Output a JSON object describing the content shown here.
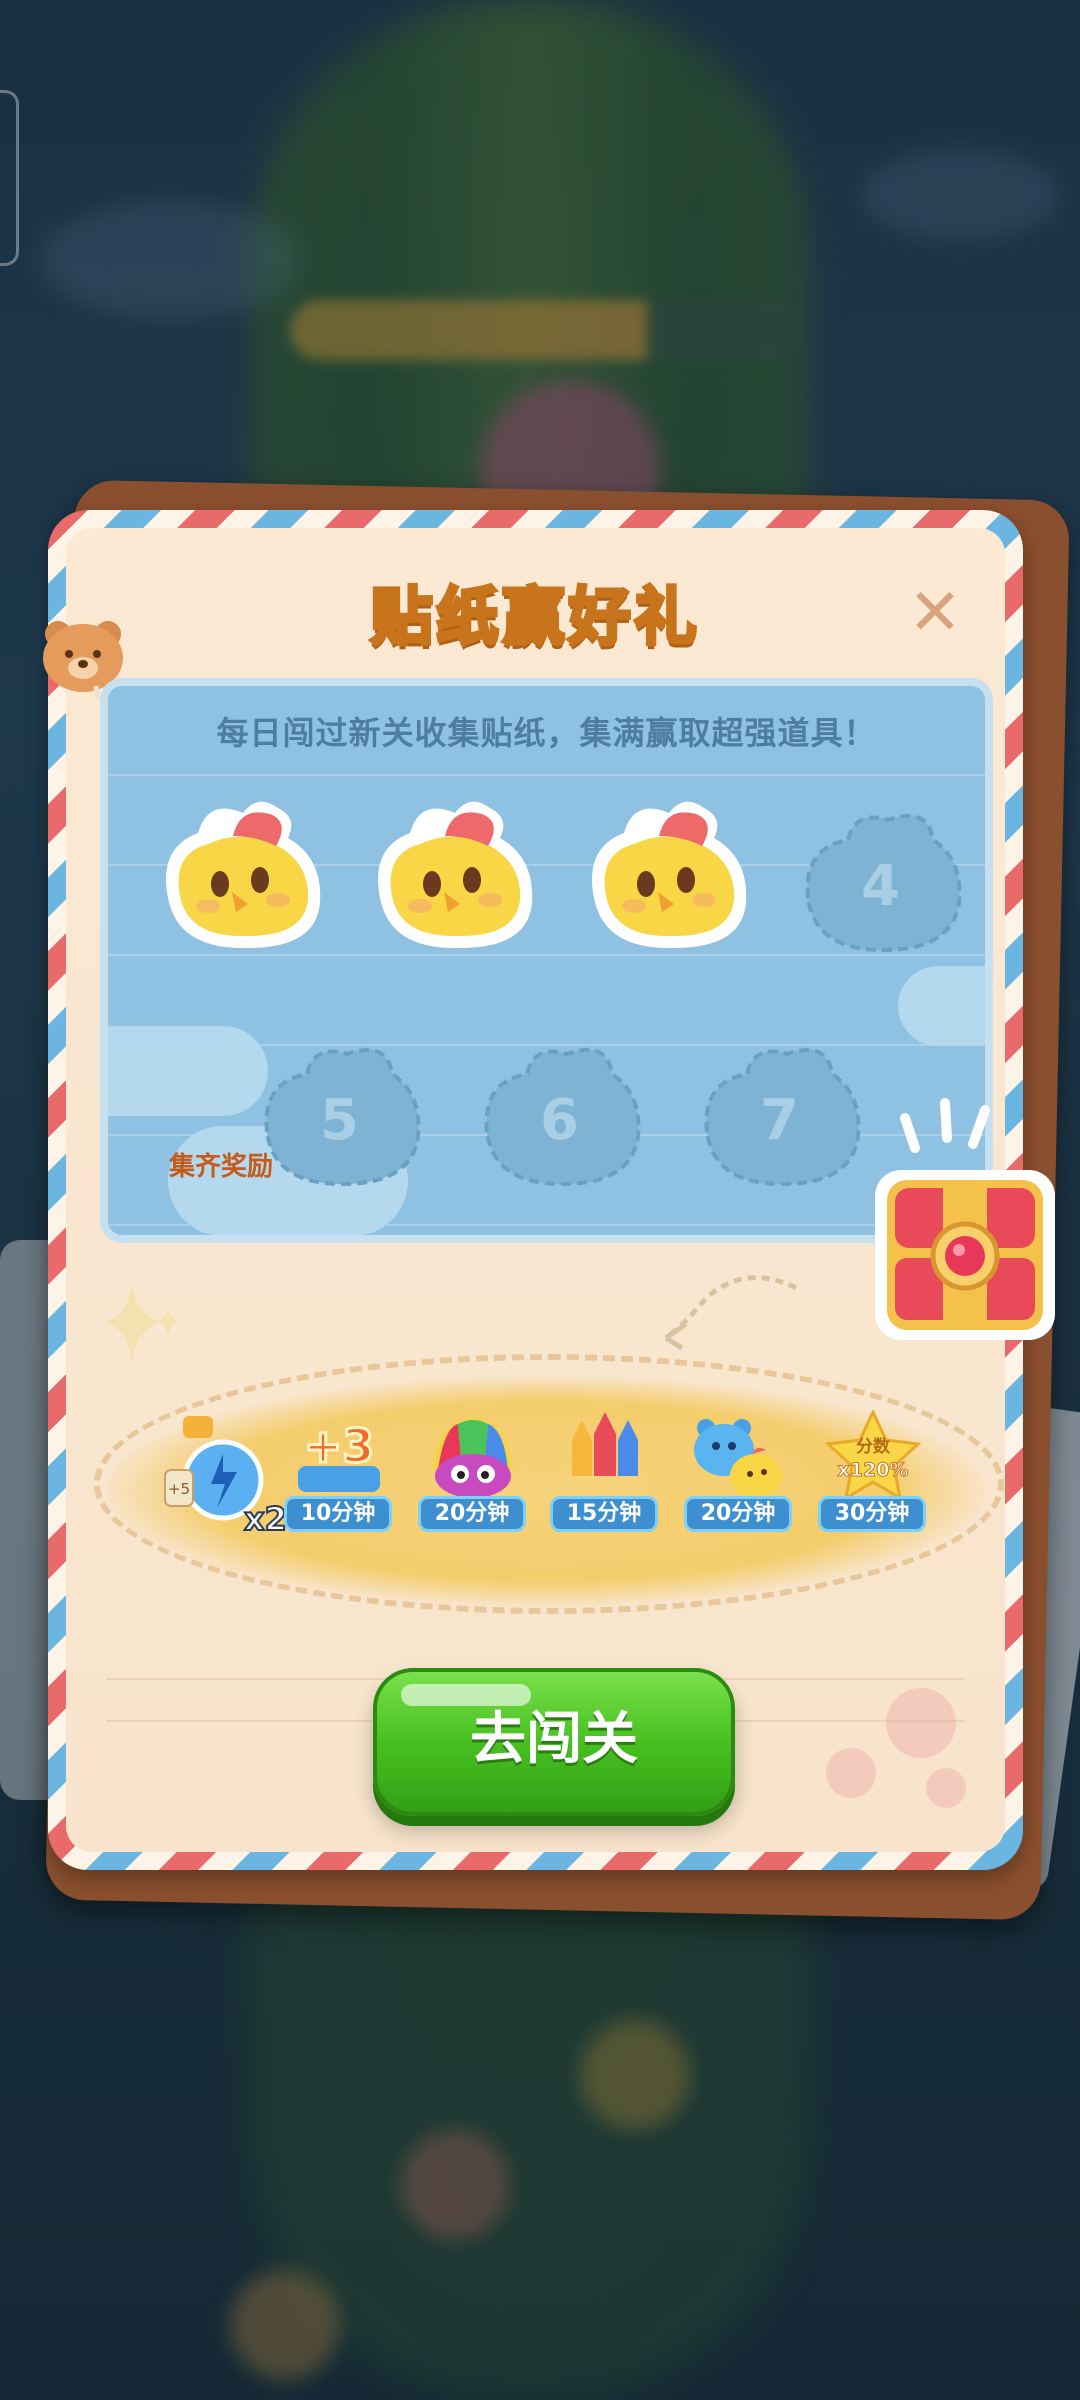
{
  "popup": {
    "title": "贴纸赢好礼",
    "subtitle": "每日闯过新关收集贴纸，集满赢取超强道具！",
    "close_icon": "close-icon",
    "collected_count": 3,
    "empty_slots": [
      "4",
      "5",
      "6",
      "7"
    ],
    "chest_label": "集齐奖励",
    "go_button": "去闯关"
  },
  "rewards": [
    {
      "icon": "energy-potion-icon",
      "badge": "+5",
      "label": "x2"
    },
    {
      "icon": "plus-moves-icon",
      "badge": "+3",
      "label": "10分钟"
    },
    {
      "icon": "rainbow-bird-icon",
      "label": "20分钟"
    },
    {
      "icon": "rockets-icon",
      "label": "15分钟"
    },
    {
      "icon": "blue-pet-chick-icon",
      "label": "20分钟"
    },
    {
      "icon": "score-star-icon",
      "badge_top": "分数",
      "badge": "x120%",
      "label": "30分钟"
    }
  ],
  "colors": {
    "title": "#f6c653",
    "board": "#8ec1e2",
    "button": "#48c021",
    "tag": "#3e8fcf"
  }
}
